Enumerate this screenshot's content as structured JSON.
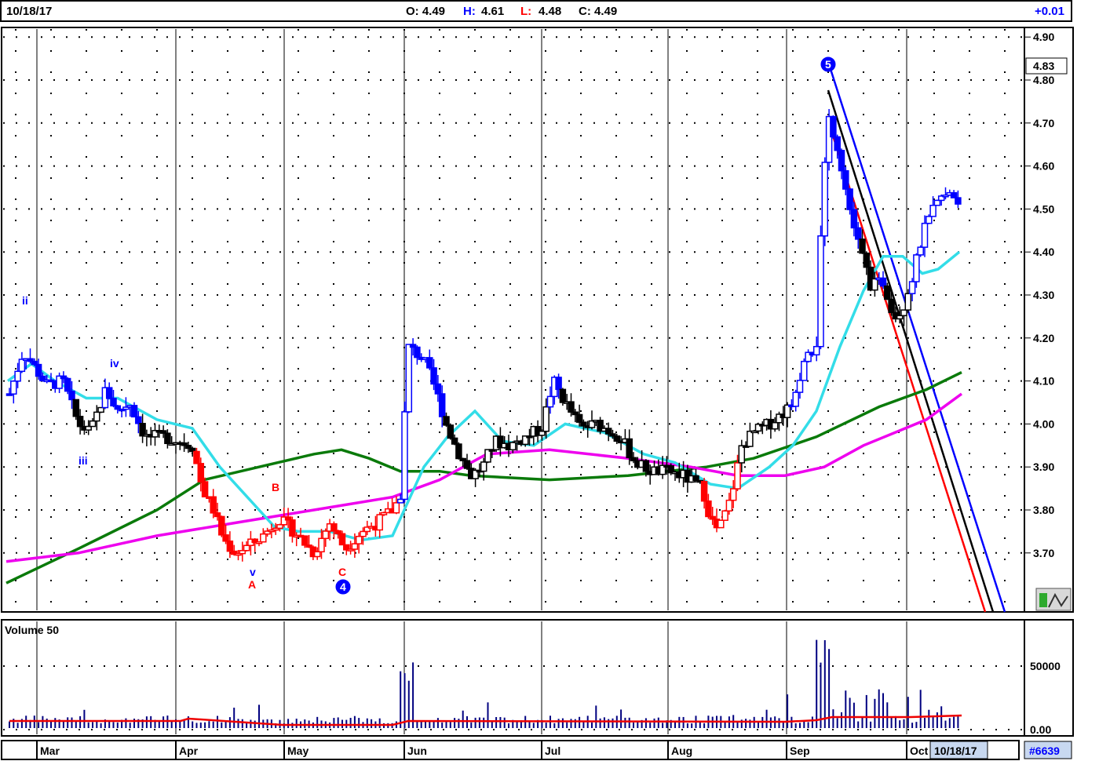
{
  "header": {
    "date": "10/18/17",
    "open": "O: 4.49",
    "high_label": "H:",
    "high_value": "4.61",
    "low_label": "L:",
    "low_value": "4.48",
    "close": "C: 4.49",
    "change": "+0.01"
  },
  "volume_panel": {
    "title": "Volume 50"
  },
  "footer": {
    "date_box": "10/18/17",
    "id_box": "#6639"
  },
  "current_price_tag": "4.83",
  "colors": {
    "blue": "#0000ff",
    "black": "#000000",
    "red": "#ff0000",
    "cyan": "#33dde8",
    "green": "#0a7a0a",
    "magenta": "#ee00ee",
    "volume_avg": "#ee0000",
    "volume_bar": "#000080"
  },
  "chart_data": {
    "type": "candlestick",
    "price_axis": {
      "ticks": [
        "4.90",
        "4.80",
        "4.70",
        "4.60",
        "4.50",
        "4.40",
        "4.30",
        "4.20",
        "4.10",
        "4.00",
        "3.90",
        "3.80",
        "3.70"
      ],
      "ylim": [
        3.6,
        4.92
      ]
    },
    "volume_axis": {
      "ticks": [
        "50000",
        "0.00"
      ]
    },
    "months": [
      "Mar",
      "Apr",
      "May",
      "Jun",
      "Jul",
      "Aug",
      "Sep",
      "Oct"
    ],
    "wave_labels": [
      {
        "text": "ii",
        "color": "blue"
      },
      {
        "text": "iii",
        "color": "blue"
      },
      {
        "text": "iv",
        "color": "blue"
      },
      {
        "text": "v",
        "color": "blue"
      },
      {
        "text": "A",
        "color": "red"
      },
      {
        "text": "B",
        "color": "red"
      },
      {
        "text": "C",
        "color": "red"
      },
      {
        "text": "4",
        "color": "blue",
        "circled": true
      },
      {
        "text": "5",
        "color": "blue",
        "circled": true
      }
    ]
  }
}
